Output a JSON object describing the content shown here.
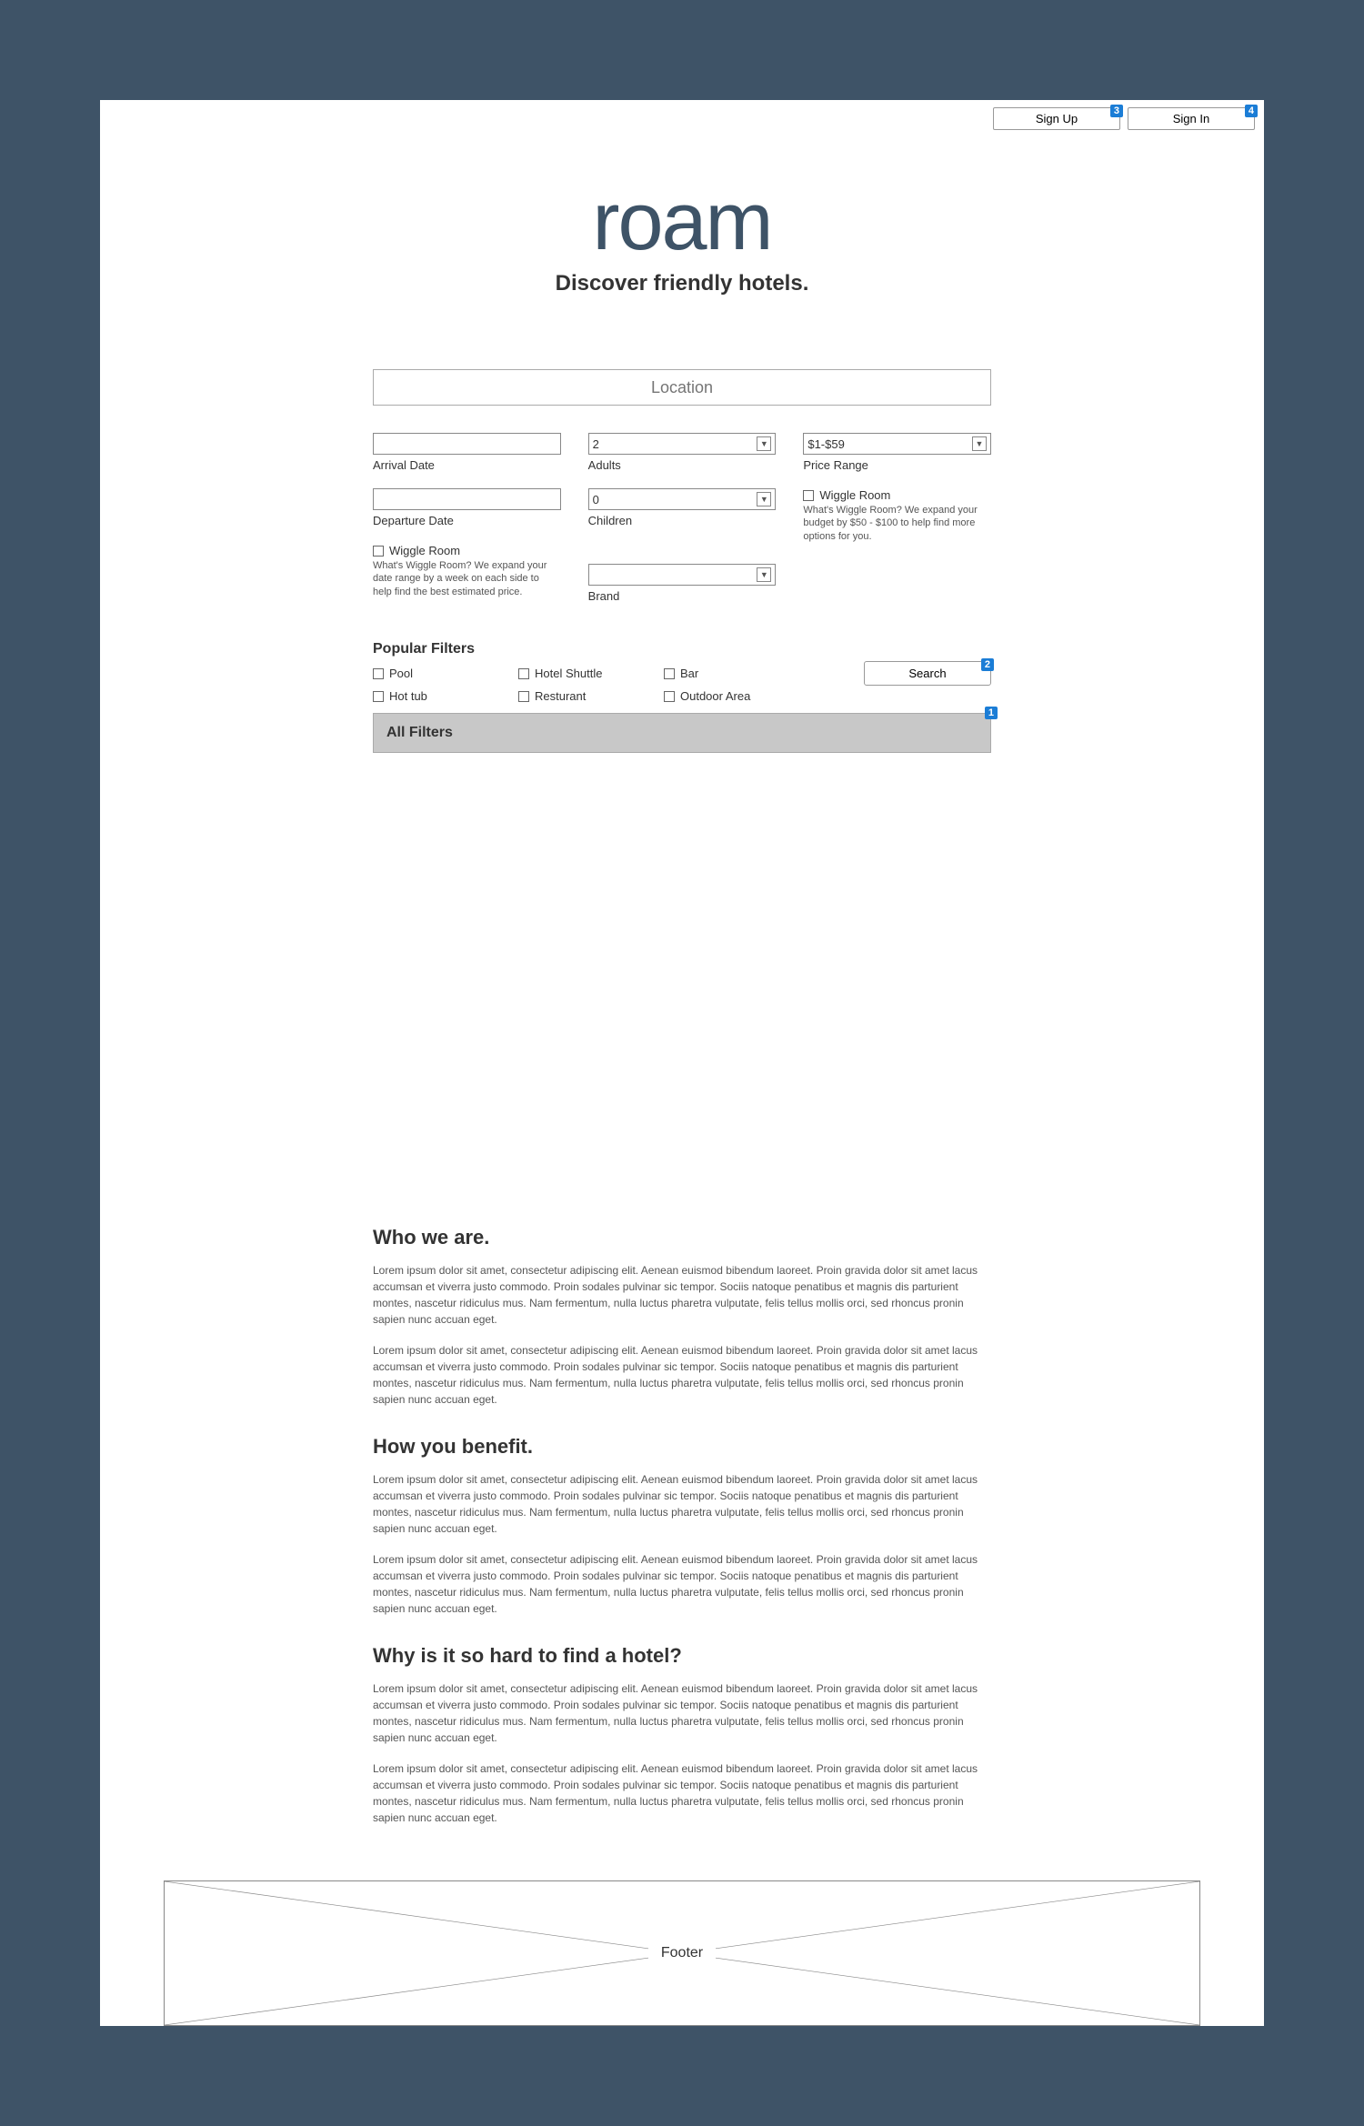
{
  "topbar": {
    "signup": "Sign Up",
    "signin": "Sign In",
    "marker_signup": "3",
    "marker_signin": "4"
  },
  "hero": {
    "logo": "roam",
    "tagline": "Discover friendly hotels."
  },
  "search": {
    "location_placeholder": "Location",
    "arrival_label": "Arrival Date",
    "departure_label": "Departure Date",
    "wiggle_date_label": "Wiggle Room",
    "wiggle_date_help": "What's Wiggle Room? We expand your date range by a week on each side to help find the best estimated price.",
    "adults_value": "2",
    "adults_label": "Adults",
    "children_value": "0",
    "children_label": "Children",
    "brand_value": "",
    "brand_label": "Brand",
    "price_value": "$1-$59",
    "price_label": "Price Range",
    "wiggle_price_label": "Wiggle Room",
    "wiggle_price_help": "What's Wiggle Room? We expand your budget by $50 - $100 to help find more options for you.",
    "popular_title": "Popular Filters",
    "filters": {
      "pool": "Pool",
      "hottub": "Hot tub",
      "shuttle": "Hotel Shuttle",
      "restaurant": "Resturant",
      "bar": "Bar",
      "outdoor": "Outdoor Area"
    },
    "search_btn": "Search",
    "marker_search": "2",
    "all_filters": "All Filters",
    "marker_allfilters": "1"
  },
  "content": {
    "who_title": "Who we are.",
    "who_p1": "Lorem ipsum dolor sit amet, consectetur adipiscing elit. Aenean euismod bibendum laoreet. Proin gravida dolor sit amet lacus accumsan et viverra justo commodo. Proin sodales pulvinar sic tempor. Sociis natoque penatibus et magnis dis parturient montes, nascetur ridiculus mus. Nam fermentum, nulla luctus pharetra vulputate, felis tellus mollis orci, sed rhoncus pronin sapien nunc accuan eget.",
    "who_p2": "Lorem ipsum dolor sit amet, consectetur adipiscing elit. Aenean euismod bibendum laoreet. Proin gravida dolor sit amet lacus accumsan et viverra justo commodo. Proin sodales pulvinar sic tempor. Sociis natoque penatibus et magnis dis parturient montes, nascetur ridiculus mus. Nam fermentum, nulla luctus pharetra vulputate, felis tellus mollis orci, sed rhoncus pronin sapien nunc accuan eget.",
    "benefit_title": "How you benefit.",
    "benefit_p1": "Lorem ipsum dolor sit amet, consectetur adipiscing elit. Aenean euismod bibendum laoreet. Proin gravida dolor sit amet lacus accumsan et viverra justo commodo. Proin sodales pulvinar sic tempor. Sociis natoque penatibus et magnis dis parturient montes, nascetur ridiculus mus. Nam fermentum, nulla luctus pharetra vulputate, felis tellus mollis orci, sed rhoncus pronin sapien nunc accuan eget.",
    "benefit_p2": "Lorem ipsum dolor sit amet, consectetur adipiscing elit. Aenean euismod bibendum laoreet. Proin gravida dolor sit amet lacus accumsan et viverra justo commodo. Proin sodales pulvinar sic tempor. Sociis natoque penatibus et magnis dis parturient montes, nascetur ridiculus mus. Nam fermentum, nulla luctus pharetra vulputate, felis tellus mollis orci, sed rhoncus pronin sapien nunc accuan eget.",
    "why_title": "Why is it so hard to find a hotel?",
    "why_p1": "Lorem ipsum dolor sit amet, consectetur adipiscing elit. Aenean euismod bibendum laoreet. Proin gravida dolor sit amet lacus accumsan et viverra justo commodo. Proin sodales pulvinar sic tempor. Sociis natoque penatibus et magnis dis parturient montes, nascetur ridiculus mus. Nam fermentum, nulla luctus pharetra vulputate, felis tellus mollis orci, sed rhoncus pronin sapien nunc accuan eget.",
    "why_p2": "Lorem ipsum dolor sit amet, consectetur adipiscing elit. Aenean euismod bibendum laoreet. Proin gravida dolor sit amet lacus accumsan et viverra justo commodo. Proin sodales pulvinar sic tempor. Sociis natoque penatibus et magnis dis parturient montes, nascetur ridiculus mus. Nam fermentum, nulla luctus pharetra vulputate, felis tellus mollis orci, sed rhoncus pronin sapien nunc accuan eget."
  },
  "footer": {
    "label": "Footer"
  }
}
